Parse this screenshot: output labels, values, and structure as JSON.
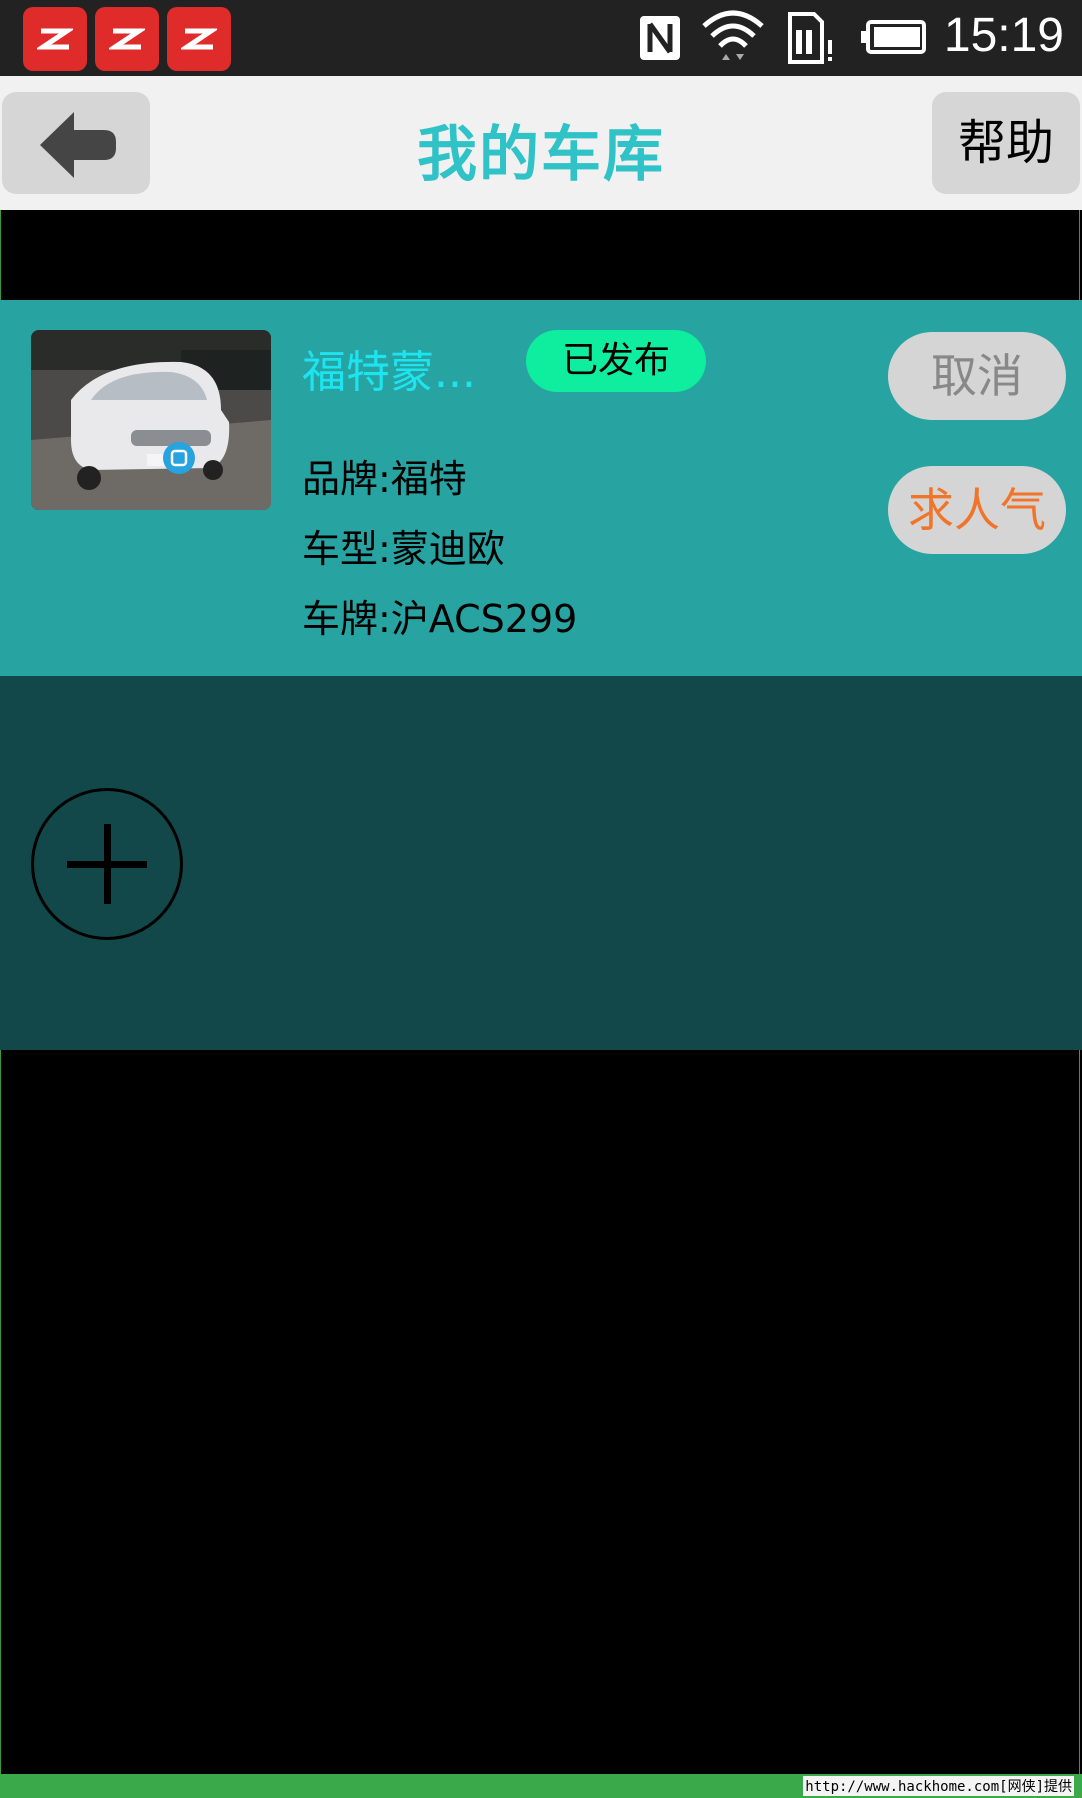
{
  "status_bar": {
    "time": "15:19",
    "icons": [
      "app-notification-icon",
      "app-notification-icon",
      "app-notification-icon",
      "nfc-icon",
      "wifi-icon",
      "sim-alert-icon",
      "battery-icon"
    ]
  },
  "header": {
    "title": "我的车库",
    "help_label": "帮助",
    "back_icon": "back-arrow-icon"
  },
  "car": {
    "name": "福特蒙...",
    "status": "已发布",
    "brand_line": "品牌:福特",
    "model_line": "车型:蒙迪欧",
    "plate_line": "车牌:沪ACS299",
    "cancel_label": "取消",
    "boost_label": "求人气"
  },
  "add_panel": {
    "add_icon": "plus-icon"
  },
  "watermark": {
    "text": "http://www.hackhome.com[网侠]提供"
  },
  "colors": {
    "title": "#2fc2c6",
    "card_bg": "#27a3a2",
    "panel_bg": "#12484a",
    "badge": "#0fed9e",
    "boost_text": "#f0752a",
    "car_name": "#1de4f0"
  }
}
